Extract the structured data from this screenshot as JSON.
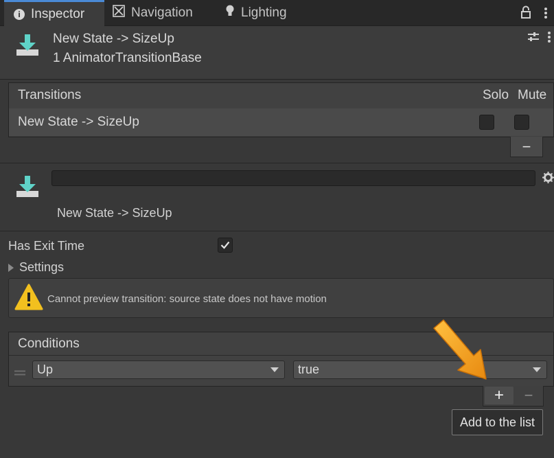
{
  "tabs": [
    {
      "label": "Inspector",
      "icon": "info-icon",
      "active": true
    },
    {
      "label": "Navigation",
      "icon": "navigation-icon",
      "active": false
    },
    {
      "label": "Lighting",
      "icon": "bulb-icon",
      "active": false
    }
  ],
  "header": {
    "title": "New State -> SizeUp",
    "subtitle": "1 AnimatorTransitionBase"
  },
  "transitions": {
    "heading": "Transitions",
    "solo_label": "Solo",
    "mute_label": "Mute",
    "rows": [
      {
        "name": "New State -> SizeUp",
        "solo": false,
        "mute": false
      }
    ],
    "remove_label": "−"
  },
  "transition": {
    "name_value": "",
    "caption": "New State -> SizeUp",
    "has_exit_time_label": "Has Exit Time",
    "has_exit_time": true,
    "settings_label": "Settings",
    "warning": "Cannot preview transition: source state does not have motion"
  },
  "conditions": {
    "heading": "Conditions",
    "rows": [
      {
        "parameter": "Up",
        "value": "true"
      }
    ],
    "add_label": "+",
    "remove_label": "−",
    "tooltip": "Add to the list"
  },
  "colors": {
    "accent": "#4a8ad6",
    "arrow": "#f5a020",
    "warning": "#f2c01f",
    "icon_teal": "#5fd3c8"
  }
}
